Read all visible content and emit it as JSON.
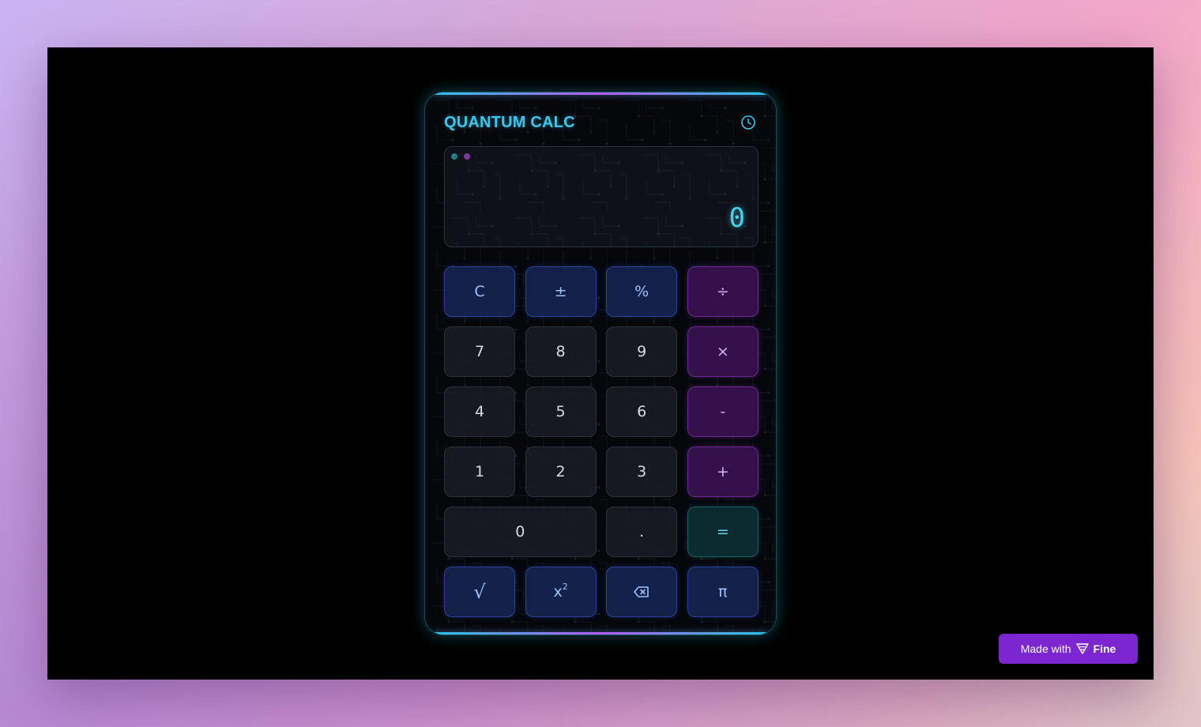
{
  "app": {
    "title": "QUANTUM CALC",
    "history_icon": "clock-icon"
  },
  "display": {
    "value": "0",
    "indicators": [
      "teal-dot",
      "purple-dot"
    ]
  },
  "keys": {
    "clear": "C",
    "plus_minus": "±",
    "percent": "%",
    "divide": "÷",
    "seven": "7",
    "eight": "8",
    "nine": "9",
    "multiply": "×",
    "four": "4",
    "five": "5",
    "six": "6",
    "minus": "-",
    "one": "1",
    "two": "2",
    "three": "3",
    "plus": "+",
    "zero": "0",
    "decimal": ".",
    "equals": "=",
    "sqrt": "√",
    "square_base": "x",
    "square_exp": "2",
    "backspace_icon": "backspace-icon",
    "pi": "π"
  },
  "badge": {
    "prefix": "Made with",
    "brand": "Fine",
    "icon": "fine-logo-icon"
  },
  "colors": {
    "accent_cyan": "#3cc8ee",
    "accent_purple": "#b45cf0",
    "badge": "#7b26d1"
  }
}
